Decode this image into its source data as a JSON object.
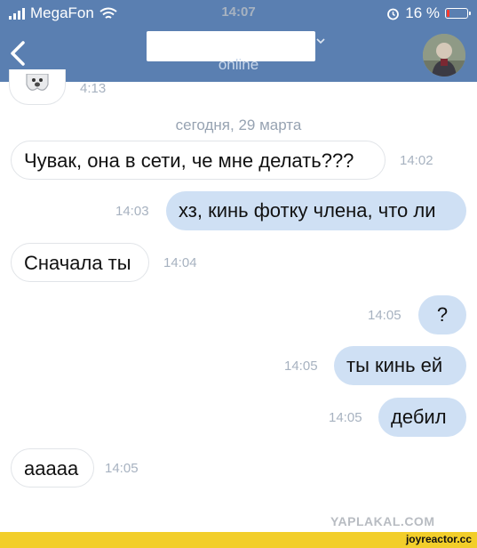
{
  "status_bar": {
    "carrier": "MegaFon",
    "time": "14:07",
    "battery": "16 %",
    "battery_level": 0.16
  },
  "header": {
    "status": "online",
    "back_icon": "chevron-left-icon",
    "name_icon": "chevron-down-icon",
    "avatar_icon": "contact-avatar"
  },
  "previous": {
    "time": "4:13",
    "icon": "ghost-sticker-icon"
  },
  "date_separator": "сегодня, 29 марта",
  "messages": [
    {
      "dir": "in",
      "text": "Чувак, она в сети, че мне делать???",
      "time": "14:02"
    },
    {
      "dir": "out",
      "text": "хз, кинь фотку члена, что ли",
      "time": "14:03"
    },
    {
      "dir": "in",
      "text": "Сначала ты",
      "time": "14:04"
    },
    {
      "dir": "out",
      "text": "?",
      "time": "14:05"
    },
    {
      "dir": "out",
      "text": "ты кинь ей",
      "time": "14:05"
    },
    {
      "dir": "out",
      "text": "дебил",
      "time": "14:05"
    },
    {
      "dir": "in",
      "text": "ааааа",
      "time": "14:05"
    }
  ],
  "watermark": "YAPLAKAL.COM",
  "footer": {
    "site": "joyreactor.cc",
    "color": "#f2ce2a"
  }
}
